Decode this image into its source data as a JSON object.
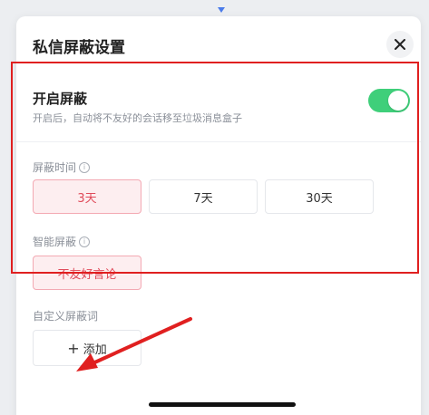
{
  "panel": {
    "title": "私信屏蔽设置"
  },
  "block_toggle": {
    "title": "开启屏蔽",
    "description": "开启后，自动将不友好的会话移至垃圾消息盒子",
    "enabled": true
  },
  "block_time": {
    "label": "屏蔽时间",
    "options": [
      "3天",
      "7天",
      "30天"
    ],
    "selected": "3天"
  },
  "smart_block": {
    "label": "智能屏蔽",
    "options": [
      "不友好言论"
    ],
    "selected": "不友好言论"
  },
  "custom_words": {
    "label": "自定义屏蔽词",
    "add_label": "添加"
  },
  "colors": {
    "accent_green": "#3fcf7a",
    "selected_red": "#e04b5a",
    "annotation_red": "#e02020"
  }
}
